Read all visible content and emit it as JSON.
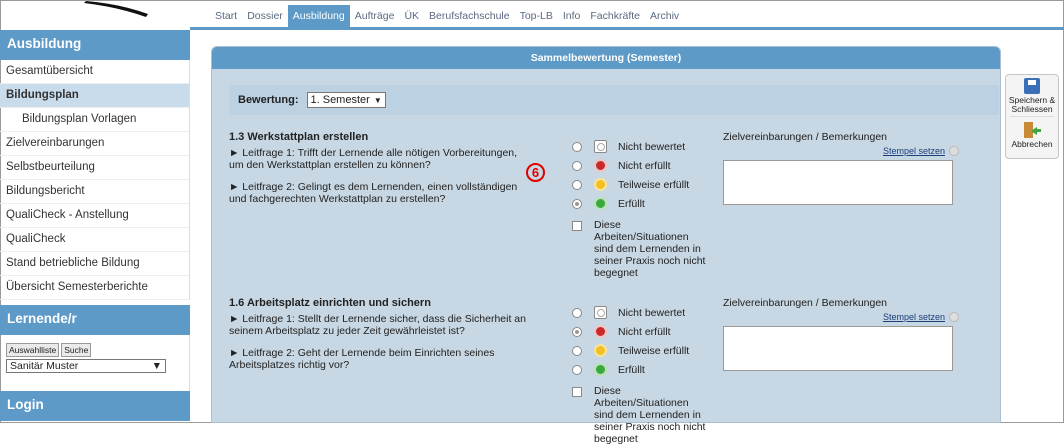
{
  "nav": {
    "tabs": [
      "Start",
      "Dossier",
      "Ausbildung",
      "Aufträge",
      "ÜK",
      "Berufsfachschule",
      "Top-LB",
      "Info",
      "Fachkräfte",
      "Archiv"
    ],
    "active": "Ausbildung"
  },
  "sidebar": {
    "section_title": "Ausbildung",
    "items": [
      {
        "label": "Gesamtübersicht"
      },
      {
        "label": "Bildungsplan",
        "active": true
      },
      {
        "label": "Bildungsplan Vorlagen",
        "sub": true
      },
      {
        "label": "Zielvereinbarungen"
      },
      {
        "label": "Selbstbeurteilung"
      },
      {
        "label": "Bildungsbericht"
      },
      {
        "label": "QualiCheck - Anstellung"
      },
      {
        "label": "QualiCheck"
      },
      {
        "label": "Stand betriebliche Bildung"
      },
      {
        "label": "Übersicht Semesterberichte"
      }
    ],
    "lernende_title": "Lernende/r",
    "auswahlliste_label": "Auswahlliste",
    "suche_label": "Suche",
    "lernende_value": "Sanitär Muster",
    "login_title": "Login"
  },
  "panel": {
    "title": "Sammelbewertung (Semester)",
    "bewertung_label": "Bewertung:",
    "bewertung_value": "1. Semester",
    "options": [
      "Nicht bewertet",
      "Nicht erfüllt",
      "Teilweise erfüllt",
      "Erfüllt"
    ],
    "checkbox_label": "Diese Arbeiten/Situationen sind dem Lernenden in seiner Praxis noch nicht begegnet",
    "zielvereinbarungen_label": "Zielvereinbarungen / Bemerkungen",
    "stempel_label": "Stempel setzen",
    "marker": "6",
    "sections": [
      {
        "title": "1.3 Werkstattplan erstellen",
        "q1": "► Leitfrage 1: Trifft der Lernende alle nötigen Vorbereitungen, um den Werkstattplan erstellen zu können?",
        "q2": "► Leitfrage 2: Gelingt es dem Lernenden, einen vollständigen und fachgerechten Werkstattplan zu erstellen?",
        "selected": 3
      },
      {
        "title": "1.6 Arbeitsplatz einrichten und sichern",
        "q1": "► Leitfrage 1: Stellt der Lernende sicher, dass die Sicherheit an seinem Arbeitsplatz zu jeder Zeit gewährleistet ist?",
        "q2": "► Leitfrage 2: Geht der Lernende beim Einrichten seines Arbeitsplatzes richtig vor?",
        "selected": 1
      }
    ]
  },
  "toolbar": {
    "save_label": "Speichern & Schliessen",
    "cancel_label": "Abbrechen"
  },
  "colors": {
    "accent": "#5d9ac7",
    "panel_bg": "#c7d7e3",
    "marker": "#e00000"
  }
}
